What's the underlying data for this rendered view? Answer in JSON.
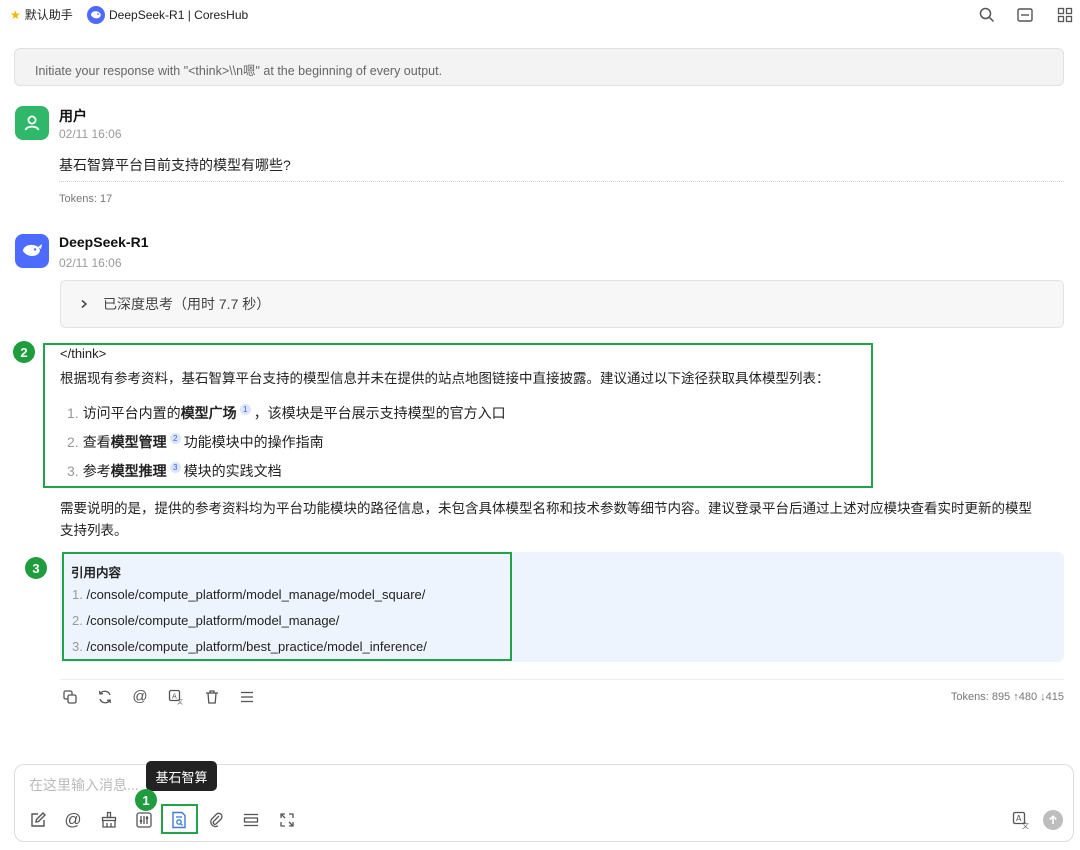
{
  "topbar": {
    "tab1_label": "默认助手",
    "tab2_label": "DeepSeek-R1 | CoresHub"
  },
  "system_prompt": "Initiate your response with \"<think>\\\\n嗯\" at the beginning of every output.",
  "user_message": {
    "name": "用户",
    "time": "02/11 16:06",
    "text": "基石智算平台目前支持的模型有哪些?",
    "tokens": "Tokens: 17"
  },
  "assistant_message": {
    "name": "DeepSeek-R1",
    "time": "02/11 16:06",
    "think_summary": "已深度思考（用时 7.7 秒）",
    "think_close_tag": "</think>",
    "intro": "根据现有参考资料，基石智算平台支持的模型信息并未在提供的站点地图链接中直接披露。建议通过以下途径获取具体模型列表：",
    "list": [
      {
        "num": "1.",
        "pre": "访问平台内置的",
        "bold": "模型广场",
        "ref": "1",
        "post": "，该模块是平台展示支持模型的官方入口"
      },
      {
        "num": "2.",
        "pre": "查看",
        "bold": "模型管理",
        "ref": "2",
        "post": "功能模块中的操作指南"
      },
      {
        "num": "3.",
        "pre": "参考",
        "bold": "模型推理",
        "ref": "3",
        "post": "模块的实践文档"
      }
    ],
    "note_line1": "需要说明的是，提供的参考资料均为平台功能模块的路径信息，未包含具体模型名称和技术参数等细节内容。建议登录平台后通过上述对应模块查看实时更新的模型",
    "note_line2": "支持列表。",
    "refs_title": "引用内容",
    "refs": [
      {
        "num": "1.",
        "path": "/console/compute_platform/model_manage/model_square/"
      },
      {
        "num": "2.",
        "path": "/console/compute_platform/model_manage/"
      },
      {
        "num": "3.",
        "path": "/console/compute_platform/best_practice/model_inference/"
      }
    ],
    "tokens": "Tokens: 895 ↑480 ↓415"
  },
  "annotations": {
    "badge1": "1",
    "badge2": "2",
    "badge3": "3"
  },
  "input": {
    "placeholder": "在这里输入消息...",
    "tooltip": "基石智算"
  },
  "colors": {
    "highlight_green": "#22a34a",
    "badge_green": "#1f9d3e",
    "user_avatar": "#2fb86a",
    "assistant_avatar": "#4d6bfe",
    "reference_bg": "#eef4fd"
  },
  "icons": {
    "topbar": [
      "star-icon",
      "deepseek-logo-icon",
      "search-icon",
      "layout-icon",
      "grid-icon"
    ],
    "message_actions": [
      "copy-icon",
      "regenerate-icon",
      "mention-icon",
      "translate-icon",
      "delete-icon",
      "menu-icon"
    ],
    "input_toolbar": [
      "edit-icon",
      "at-icon",
      "broom-icon",
      "settings-sliders-icon",
      "knowledge-base-icon",
      "paperclip-icon",
      "divider-icon",
      "expand-icon",
      "translate-icon",
      "send-icon"
    ]
  }
}
